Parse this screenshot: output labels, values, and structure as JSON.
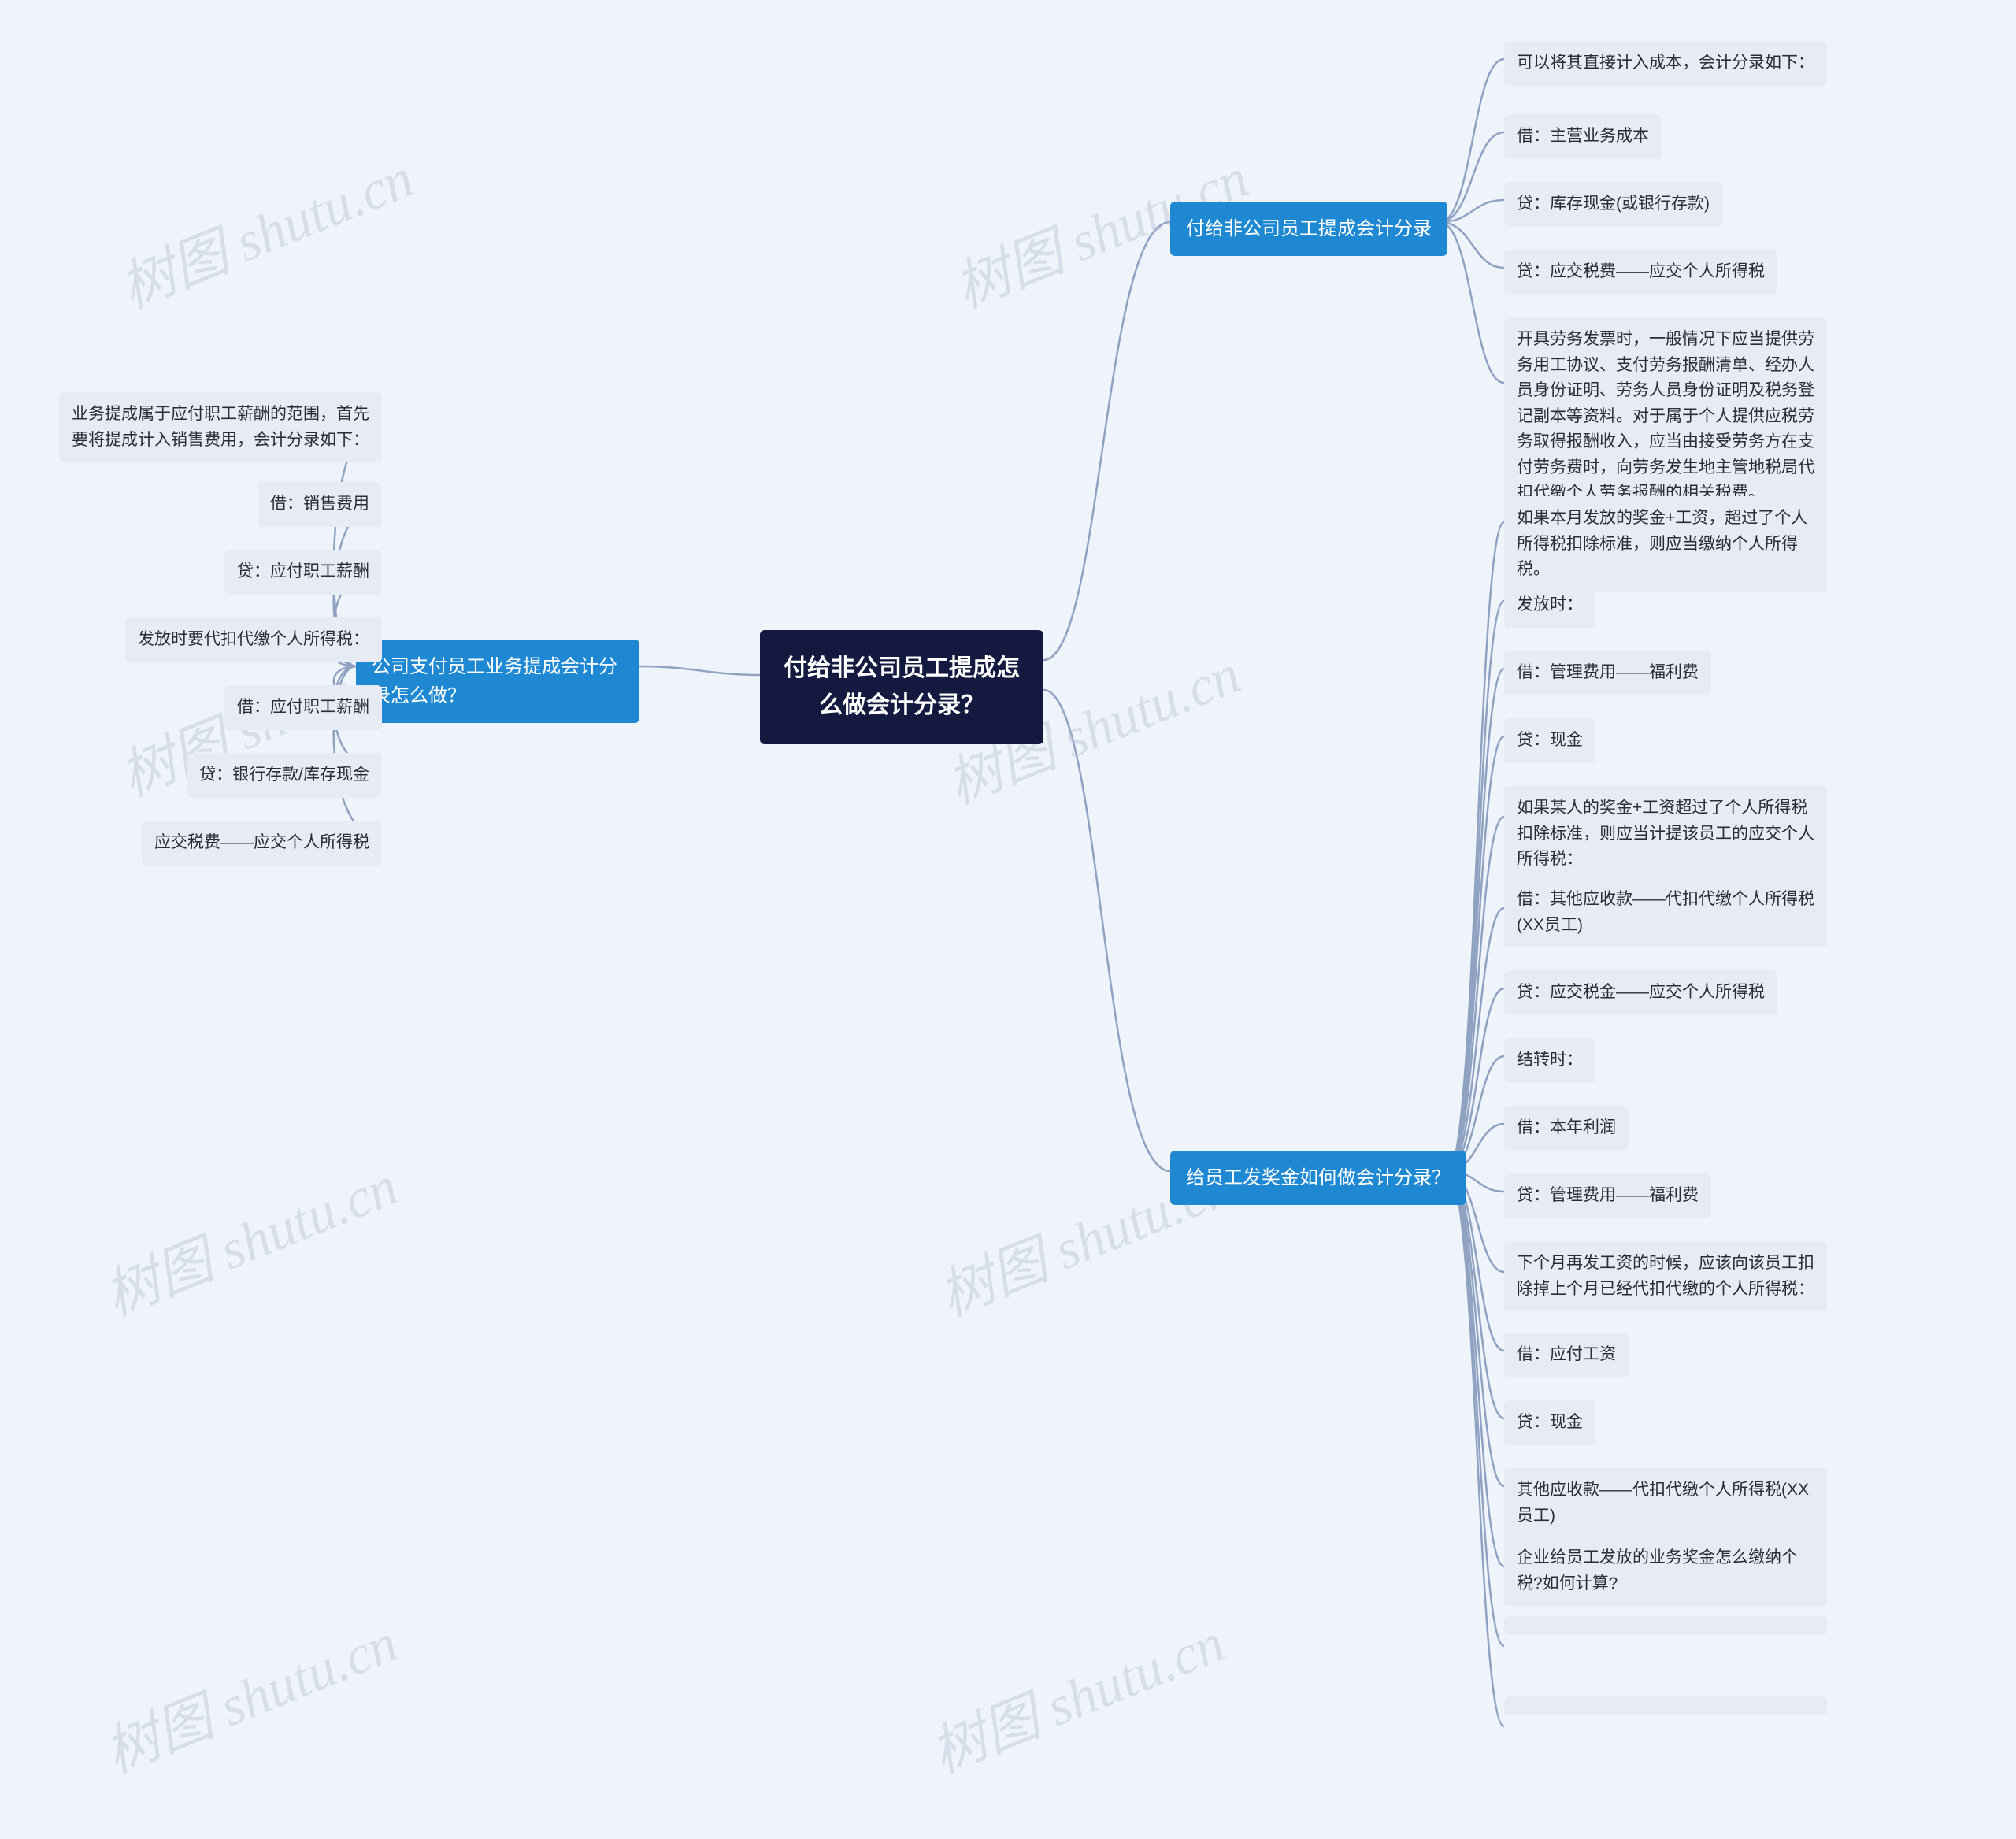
{
  "watermark": "树图 shutu.cn",
  "root": "付给非公司员工提成怎么做会计分录？",
  "left": {
    "branch": "公司支付员工业务提成会计分录怎么做？",
    "leaves": [
      "业务提成属于应付职工薪酬的范围，首先要将提成计入销售费用，会计分录如下：",
      "借：销售费用",
      "贷：应付职工薪酬",
      "发放时要代扣代缴个人所得税：",
      "借：应付职工薪酬",
      "贷：银行存款/库存现金",
      "应交税费——应交个人所得税"
    ]
  },
  "right1": {
    "branch": "付给非公司员工提成会计分录",
    "leaves": [
      "可以将其直接计入成本，会计分录如下：",
      "借：主营业务成本",
      "贷：库存现金(或银行存款)",
      "贷：应交税费——应交个人所得税",
      "开具劳务发票时，一般情况下应当提供劳务用工协议、支付劳务报酬清单、经办人员身份证明、劳务人员身份证明及税务登记副本等资料。对于属于个人提供应税劳务取得报酬收入，应当由接受劳务方在支付劳务费时，向劳务发生地主管地税局代扣代缴个人劳务报酬的相关税费。"
    ]
  },
  "right2": {
    "branch": "给员工发奖金如何做会计分录？",
    "leaves": [
      "如果本月发放的奖金+工资，超过了个人所得税扣除标准，则应当缴纳个人所得税。",
      "发放时：",
      "借：管理费用——福利费",
      "贷：现金",
      "如果某人的奖金+工资超过了个人所得税扣除标准，则应当计提该员工的应交个人所得税：",
      "借：其他应收款——代扣代缴个人所得税(XX员工)",
      "贷：应交税金——应交个人所得税",
      "结转时：",
      "借：本年利润",
      "贷：管理费用——福利费",
      "下个月再发工资的时候，应该向该员工扣除掉上个月已经代扣代缴的个人所得税：",
      "借：应付工资",
      "贷：现金",
      "其他应收款——代扣代缴个人所得税(XX员工)",
      "企业给员工发放的业务奖金怎么缴纳个税?如何计算?"
    ]
  }
}
